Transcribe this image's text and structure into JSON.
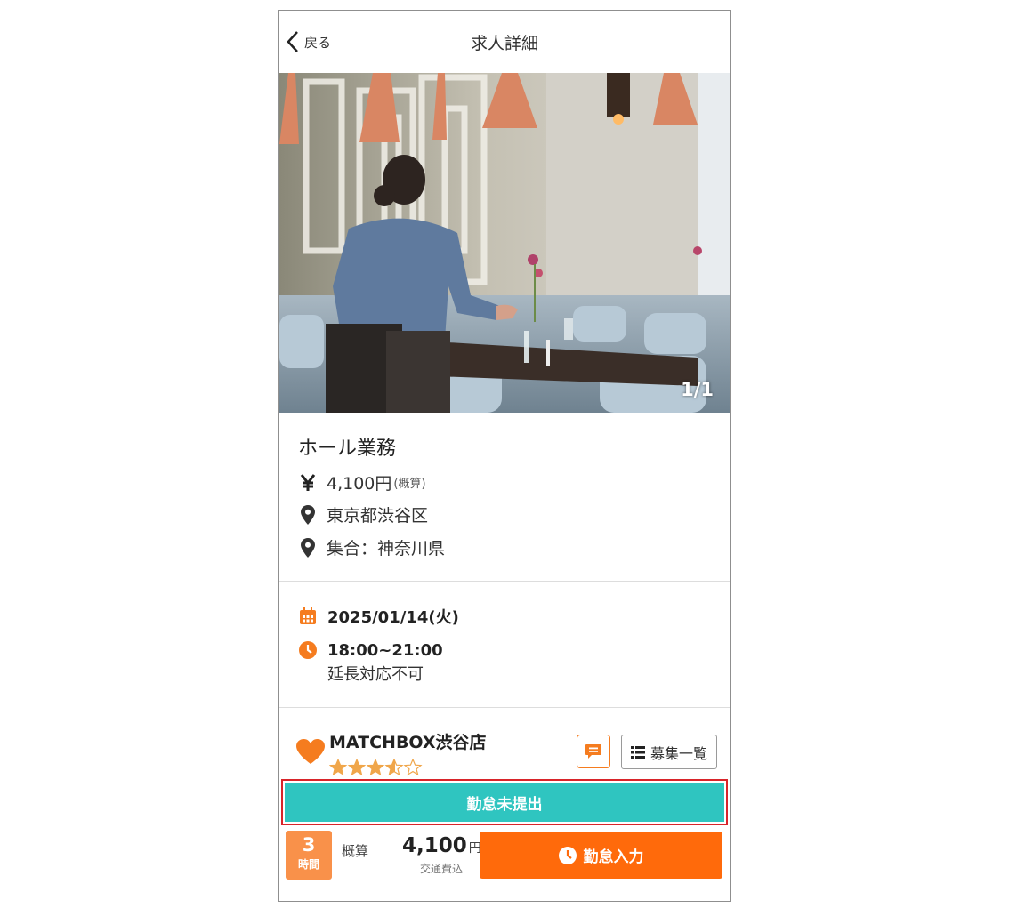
{
  "header": {
    "back_label": "戻る",
    "title": "求人詳細"
  },
  "photo": {
    "counter": "1/1"
  },
  "job": {
    "title": "ホール業務",
    "wage": "4,100円",
    "wage_note": "(概算)",
    "location": "東京都渋谷区",
    "meeting": "集合：神奈川県"
  },
  "schedule": {
    "date": "2025/01/14(火)",
    "time": "18:00~21:00",
    "extension_note": "延長対応不可"
  },
  "store": {
    "name": "MATCHBOX渋谷店",
    "rating": 3.5,
    "rating_stars": "★★★⯪☆",
    "list_button": "募集一覧"
  },
  "status_bar": {
    "label": "勤怠未提出"
  },
  "footer": {
    "hours_value": "3",
    "hours_unit": "時間",
    "estimate_label": "概算",
    "amount": "4,100",
    "currency": "円",
    "transport_note": "交通費込",
    "attendance_button": "勤怠入力"
  },
  "colors": {
    "accent": "#ff6a0b",
    "teal": "#2fc5c0",
    "highlight_border": "#d8242a",
    "hours_badge": "#f9914a",
    "star": "#f0a64a"
  },
  "icons": [
    "chevron-left-icon",
    "yen-icon",
    "map-pin-icon",
    "calendar-icon",
    "clock-icon",
    "heart-icon",
    "chat-icon",
    "list-icon"
  ]
}
